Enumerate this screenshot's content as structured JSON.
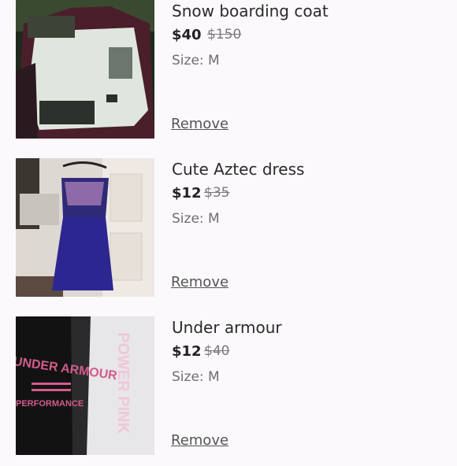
{
  "items": [
    {
      "title": "Snow boarding coat",
      "price": "$40",
      "original_price": "$150",
      "size": "Size: M",
      "remove_label": "Remove"
    },
    {
      "title": "Cute Aztec dress",
      "price": "$12",
      "original_price": "$35",
      "size": "Size: M",
      "remove_label": "Remove"
    },
    {
      "title": "Under armour",
      "price": "$12",
      "original_price": "$40",
      "size": "Size: M",
      "remove_label": "Remove"
    }
  ],
  "photo_text": {
    "under_armour_front": "UNDER ARMOUR",
    "under_armour_sub": "PERFORMANCE",
    "pink_power": "POWER PINK"
  },
  "colors": {
    "background": "#fbf9fb",
    "text": "#2a2a2a",
    "muted": "#6f6f6f"
  }
}
